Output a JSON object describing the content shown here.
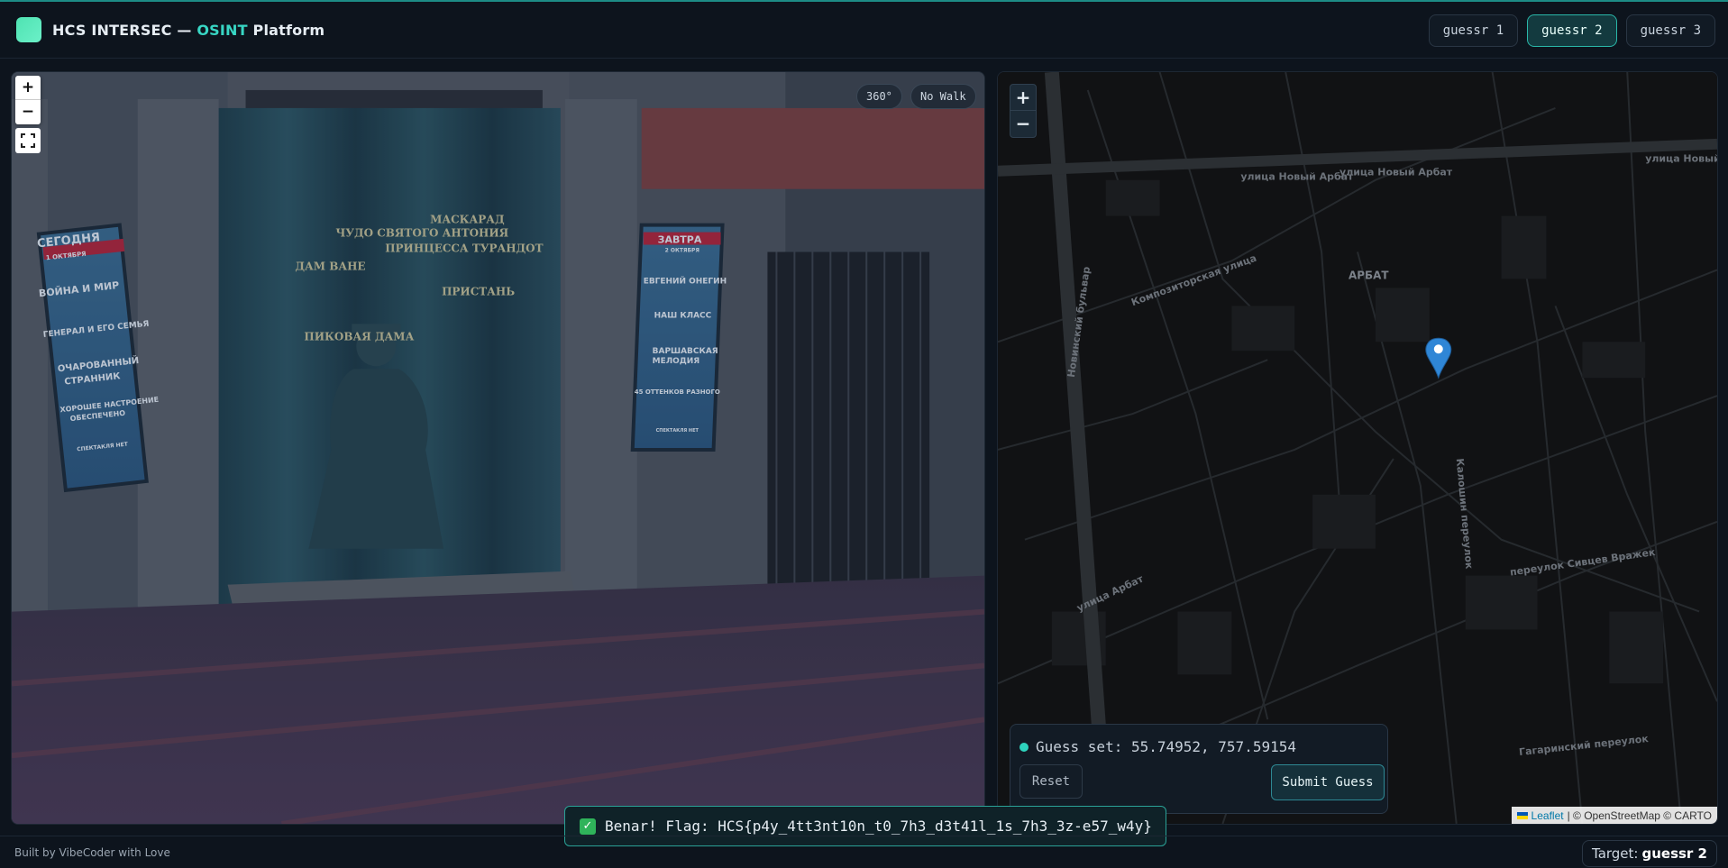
{
  "header": {
    "brand_prefix": "HCS INTERSEC — ",
    "brand_accent": "OSINT",
    "brand_suffix": " Platform",
    "tabs": [
      {
        "label": "guessr 1",
        "active": false
      },
      {
        "label": "guessr 2",
        "active": true
      },
      {
        "label": "guessr 3",
        "active": false
      }
    ]
  },
  "panorama": {
    "zoom_in": "+",
    "zoom_out": "−",
    "mode_badge": "360°",
    "walk_badge": "No Walk",
    "left_poster": {
      "title": "СЕГОДНЯ",
      "date": "1 ОКТЯБРЯ",
      "lines": [
        "ВОЙНА И МИР",
        "ГЕНЕРАЛ И ЕГО СЕМЬЯ",
        "ОЧАРОВАННЫЙ",
        "СТРАННИК",
        "ХОРОШЕЕ НАСТРОЕНИЕ",
        "ОБЕСПЕЧЕНО",
        "СПЕКТАКЛЯ НЕТ"
      ]
    },
    "right_poster": {
      "title": "ЗАВТРА",
      "date": "2 ОКТЯБРЯ",
      "lines": [
        "ЕВГЕНИЙ ОНЕГИН",
        "НАШ КЛАСС",
        "ВАРШАВСКАЯ",
        "МЕЛОДИЯ",
        "45 ОТТЕНКОВ РАЗНОГО",
        "СПЕКТАКЛЯ НЕТ"
      ]
    },
    "curtain_words": [
      "ЧУДО СВЯТОГО АНТОНИЯ",
      "ПРИНЦЕССА ТУРАНДОТ",
      "МАСКАРАД",
      "ПРИСТАНЬ",
      "ДАМ ВАНЕ",
      "ПИКОВАЯ ДАМА"
    ]
  },
  "map": {
    "zoom_in": "+",
    "zoom_out": "−",
    "district_label": "АРБАТ",
    "street_labels": [
      "улица Новый Арбат",
      "улица Новый Арбат",
      "улица Новый",
      "Новинский бульвар",
      "переулок Сивцев Вражек",
      "Гагаринский переулок",
      "улица Арбат",
      "Композиторская улица",
      "Калошин переулок"
    ],
    "attribution_leaflet": "Leaflet",
    "attribution_rest": "| © OpenStreetMap © CARTO",
    "pin_color": "#2f86d6"
  },
  "guess": {
    "status_text": "Guess set: 55.74952, 757.59154",
    "reset_label": "Reset",
    "submit_label": "Submit Guess"
  },
  "toast": {
    "check": "✓",
    "message": "Benar! Flag: HCS{p4y_4tt3nt10n_t0_7h3_d3t41l_1s_7h3_3z-e57_w4y}"
  },
  "footer": {
    "note": "Built by VibeCoder with Love",
    "target_label": "Target:",
    "target_value": "guessr 2"
  },
  "colors": {
    "accent": "#38d6c4",
    "background": "#0d141d"
  }
}
